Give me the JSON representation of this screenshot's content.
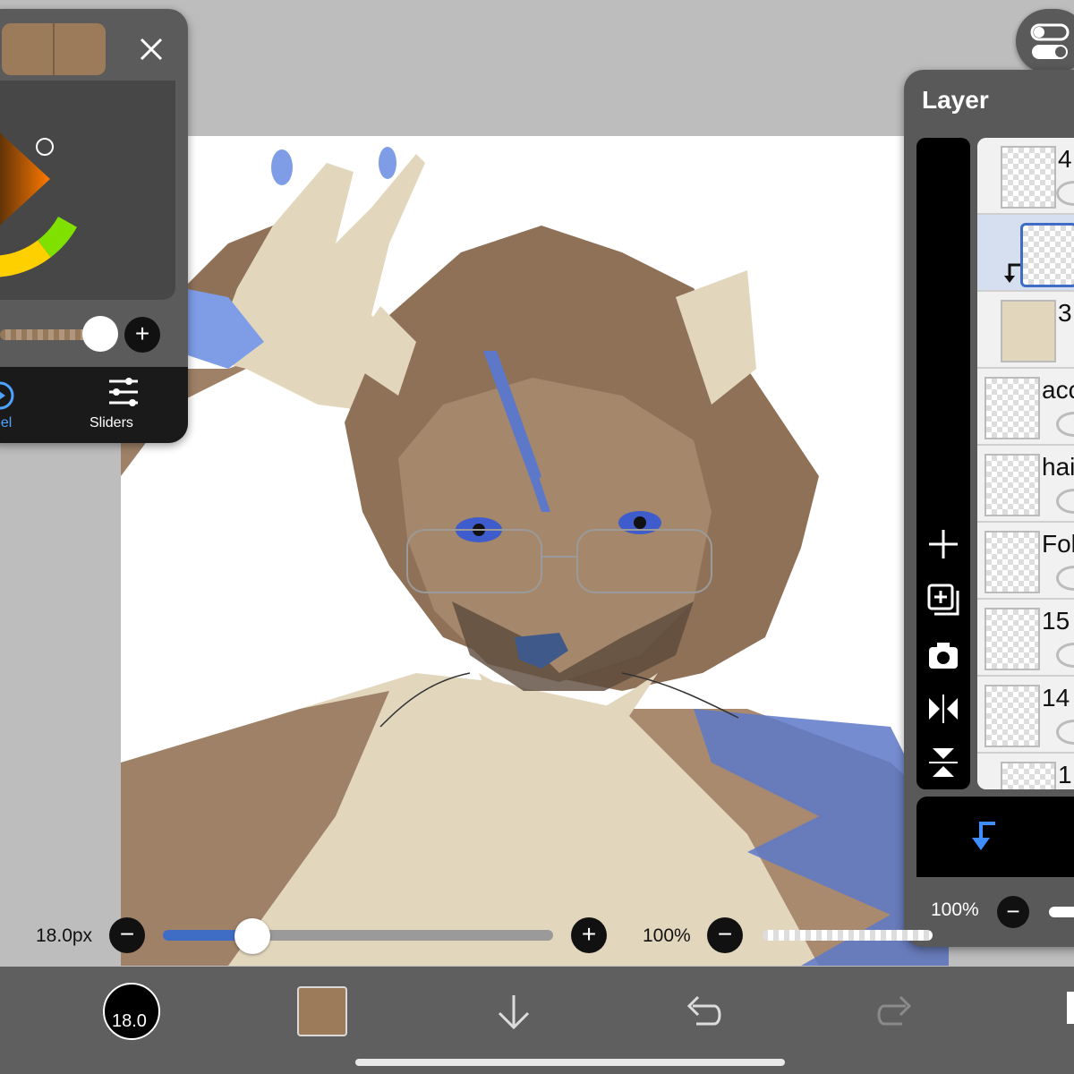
{
  "color_panel": {
    "primary_color": "#9c7b5b",
    "tabs": [
      {
        "label": "eel",
        "icon": "wheel-icon",
        "active": true
      },
      {
        "label": "Sliders",
        "icon": "sliders-icon",
        "active": false
      }
    ]
  },
  "layer_panel": {
    "title": "Layer",
    "layers": [
      {
        "name": "4",
        "type": "layer",
        "selected": false
      },
      {
        "name": "",
        "type": "layer",
        "selected": true,
        "clipping": true
      },
      {
        "name": "3",
        "type": "layer",
        "selected": false
      },
      {
        "name": "acc",
        "type": "folder",
        "selected": false
      },
      {
        "name": "hai",
        "type": "folder",
        "selected": false
      },
      {
        "name": "Fol",
        "type": "folder",
        "selected": false
      },
      {
        "name": "15",
        "type": "layer",
        "selected": false
      },
      {
        "name": "14",
        "type": "layer",
        "selected": false
      },
      {
        "name": "1",
        "type": "layer",
        "selected": false
      }
    ],
    "opacity": "100%"
  },
  "brush": {
    "size_label": "18.0px",
    "size_fraction": 0.23,
    "opacity_label": "100%"
  },
  "toolbar": {
    "brush_size_short": "18.0",
    "color": "#9c7b5b"
  }
}
